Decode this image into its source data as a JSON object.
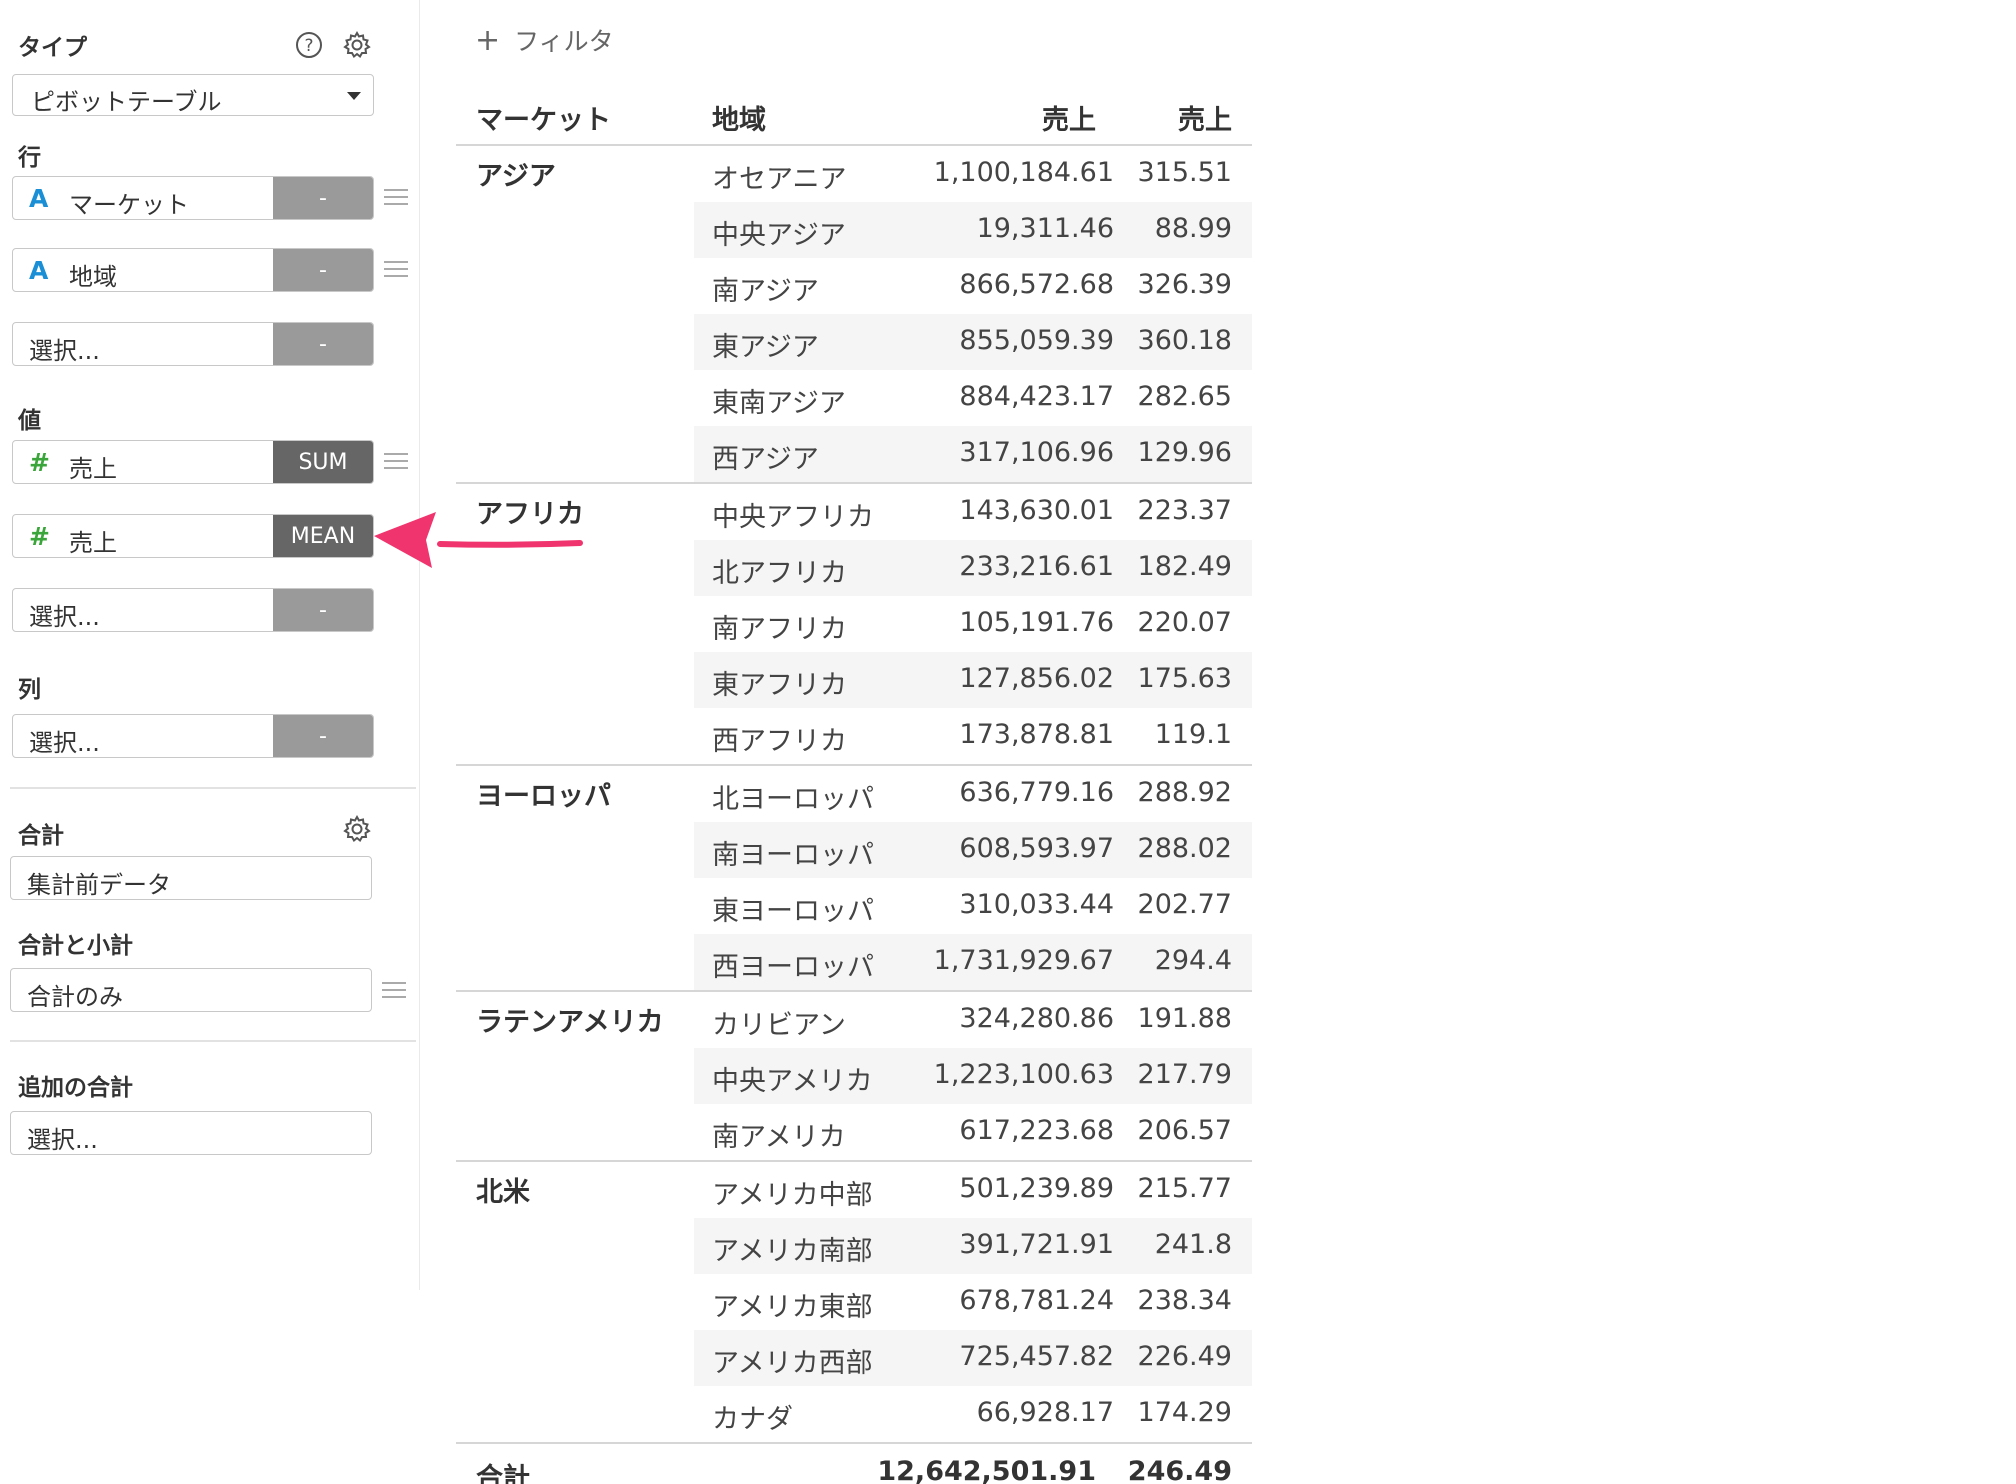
{
  "sidebar": {
    "type_label": "タイプ",
    "type_value": "ピボットテーブル",
    "rows_label": "行",
    "row_fields": [
      {
        "icon": "A",
        "label": "マーケット",
        "agg": "-"
      },
      {
        "icon": "A",
        "label": "地域",
        "agg": "-"
      },
      {
        "icon": "",
        "label": "選択...",
        "agg": "-"
      }
    ],
    "values_label": "値",
    "value_fields": [
      {
        "icon": "#",
        "label": "売上",
        "agg": "SUM"
      },
      {
        "icon": "#",
        "label": "売上",
        "agg": "MEAN"
      },
      {
        "icon": "",
        "label": "選択...",
        "agg": "-"
      }
    ],
    "columns_label": "列",
    "column_fields": [
      {
        "icon": "",
        "label": "選択...",
        "agg": "-"
      }
    ],
    "total_label": "合計",
    "total_value": "集計前データ",
    "subtotal_label": "合計と小計",
    "subtotal_value": "合計のみ",
    "extra_total_label": "追加の合計",
    "extra_total_value": "選択..."
  },
  "main": {
    "filter_label": "フィルタ",
    "filter_plus": "+"
  },
  "table": {
    "headers": [
      "マーケット",
      "地域",
      "売上",
      "売上"
    ],
    "groups": [
      {
        "market": "アジア",
        "rows": [
          {
            "region": "オセアニア",
            "sum": "1,100,184.61",
            "mean": "315.51"
          },
          {
            "region": "中央アジア",
            "sum": "19,311.46",
            "mean": "88.99"
          },
          {
            "region": "南アジア",
            "sum": "866,572.68",
            "mean": "326.39"
          },
          {
            "region": "東アジア",
            "sum": "855,059.39",
            "mean": "360.18"
          },
          {
            "region": "東南アジア",
            "sum": "884,423.17",
            "mean": "282.65"
          },
          {
            "region": "西アジア",
            "sum": "317,106.96",
            "mean": "129.96"
          }
        ]
      },
      {
        "market": "アフリカ",
        "rows": [
          {
            "region": "中央アフリカ",
            "sum": "143,630.01",
            "mean": "223.37"
          },
          {
            "region": "北アフリカ",
            "sum": "233,216.61",
            "mean": "182.49"
          },
          {
            "region": "南アフリカ",
            "sum": "105,191.76",
            "mean": "220.07"
          },
          {
            "region": "東アフリカ",
            "sum": "127,856.02",
            "mean": "175.63"
          },
          {
            "region": "西アフリカ",
            "sum": "173,878.81",
            "mean": "119.1"
          }
        ]
      },
      {
        "market": "ヨーロッパ",
        "rows": [
          {
            "region": "北ヨーロッパ",
            "sum": "636,779.16",
            "mean": "288.92"
          },
          {
            "region": "南ヨーロッパ",
            "sum": "608,593.97",
            "mean": "288.02"
          },
          {
            "region": "東ヨーロッパ",
            "sum": "310,033.44",
            "mean": "202.77"
          },
          {
            "region": "西ヨーロッパ",
            "sum": "1,731,929.67",
            "mean": "294.4"
          }
        ]
      },
      {
        "market": "ラテンアメリカ",
        "rows": [
          {
            "region": "カリビアン",
            "sum": "324,280.86",
            "mean": "191.88"
          },
          {
            "region": "中央アメリカ",
            "sum": "1,223,100.63",
            "mean": "217.79"
          },
          {
            "region": "南アメリカ",
            "sum": "617,223.68",
            "mean": "206.57"
          }
        ]
      },
      {
        "market": "北米",
        "rows": [
          {
            "region": "アメリカ中部",
            "sum": "501,239.89",
            "mean": "215.77"
          },
          {
            "region": "アメリカ南部",
            "sum": "391,721.91",
            "mean": "241.8"
          },
          {
            "region": "アメリカ東部",
            "sum": "678,781.24",
            "mean": "238.34"
          },
          {
            "region": "アメリカ西部",
            "sum": "725,457.82",
            "mean": "226.49"
          },
          {
            "region": "カナダ",
            "sum": "66,928.17",
            "mean": "174.29"
          }
        ]
      }
    ],
    "total": {
      "label": "合計",
      "sum": "12,642,501.91",
      "mean": "246.49"
    }
  },
  "colors": {
    "text_icon": "#1a8fd6",
    "number_icon": "#3aa53a",
    "agg_button": "#9a9a9a",
    "agg_button_active": "#666666",
    "arrow": "#f0346e"
  },
  "icons": [
    "help-icon",
    "gear-icon",
    "chevron-down-icon",
    "drag-handle-icon",
    "plus-icon",
    "arrow-annotation"
  ]
}
